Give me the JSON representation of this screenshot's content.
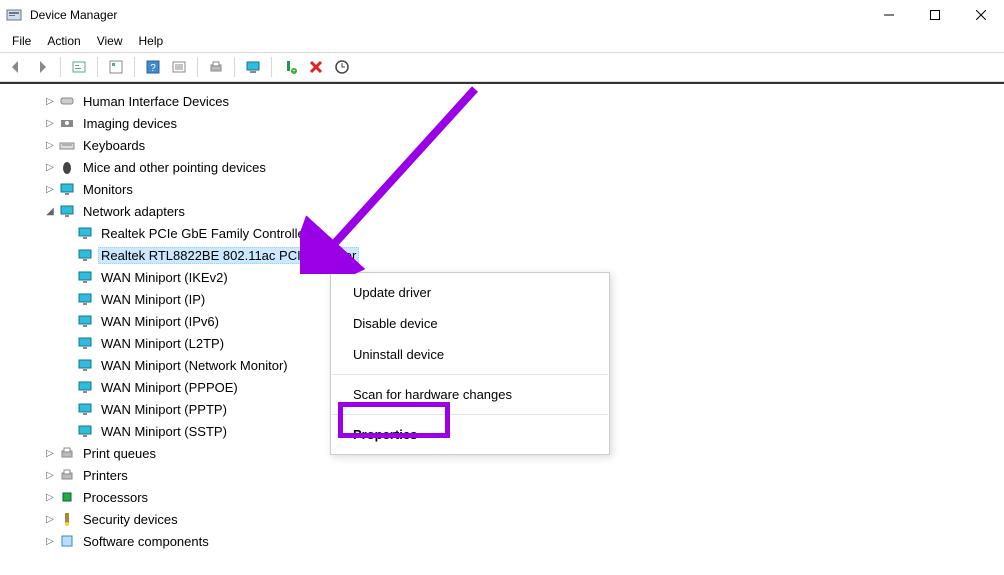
{
  "window": {
    "title": "Device Manager"
  },
  "menubar": {
    "items": [
      "File",
      "Action",
      "View",
      "Help"
    ]
  },
  "toolbar_buttons": [
    "back",
    "forward",
    "show-hidden",
    "properties-tb",
    "help-tb",
    "details",
    "print",
    "pc",
    "add",
    "remove",
    "refresh"
  ],
  "tree": {
    "nodes": [
      {
        "label": "Human Interface Devices",
        "icon": "hid"
      },
      {
        "label": "Imaging devices",
        "icon": "imaging"
      },
      {
        "label": "Keyboards",
        "icon": "keyboard"
      },
      {
        "label": "Mice and other pointing devices",
        "icon": "mouse"
      },
      {
        "label": "Monitors",
        "icon": "monitor"
      }
    ],
    "network": {
      "label": "Network adapters",
      "icon": "network",
      "children": [
        {
          "label": "Realtek PCIe GbE Family Controller",
          "selected": false
        },
        {
          "label": "Realtek RTL8822BE 802.11ac PCIe Adapter",
          "selected": true
        },
        {
          "label": "WAN Miniport (IKEv2)",
          "selected": false
        },
        {
          "label": "WAN Miniport (IP)",
          "selected": false
        },
        {
          "label": "WAN Miniport (IPv6)",
          "selected": false
        },
        {
          "label": "WAN Miniport (L2TP)",
          "selected": false
        },
        {
          "label": "WAN Miniport (Network Monitor)",
          "selected": false
        },
        {
          "label": "WAN Miniport (PPPOE)",
          "selected": false
        },
        {
          "label": "WAN Miniport (PPTP)",
          "selected": false
        },
        {
          "label": "WAN Miniport (SSTP)",
          "selected": false
        }
      ]
    },
    "after": [
      {
        "label": "Print queues",
        "icon": "printqueue"
      },
      {
        "label": "Printers",
        "icon": "printer"
      },
      {
        "label": "Processors",
        "icon": "cpu"
      },
      {
        "label": "Security devices",
        "icon": "security"
      },
      {
        "label": "Software components",
        "icon": "software"
      }
    ]
  },
  "context_menu": {
    "items": [
      {
        "label": "Update driver",
        "bold": false
      },
      {
        "label": "Disable device",
        "bold": false
      },
      {
        "label": "Uninstall device",
        "bold": false
      },
      {
        "sep": true
      },
      {
        "label": "Scan for hardware changes",
        "bold": false
      },
      {
        "sep": true
      },
      {
        "label": "Properties",
        "bold": true
      }
    ]
  }
}
